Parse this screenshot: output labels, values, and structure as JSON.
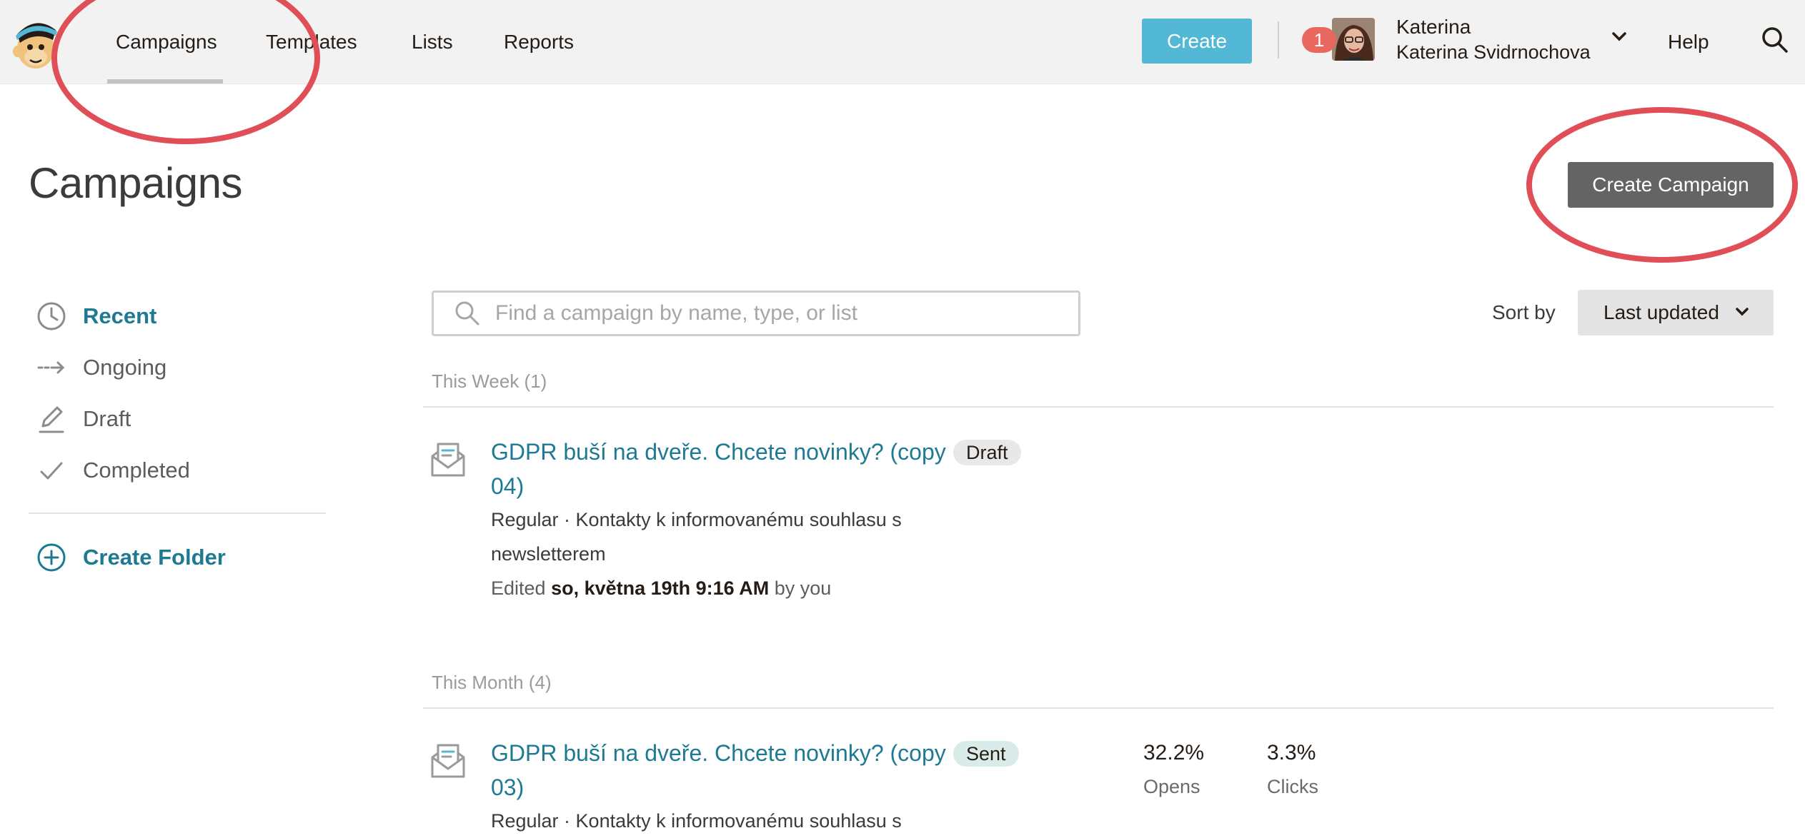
{
  "nav": {
    "items": [
      "Campaigns",
      "Templates",
      "Lists",
      "Reports"
    ],
    "create_label": "Create",
    "notification_count": "1",
    "user_name": "Katerina",
    "user_fullname": "Katerina Svidrnochova",
    "help_label": "Help"
  },
  "page": {
    "title": "Campaigns",
    "create_campaign_label": "Create Campaign"
  },
  "sidebar": {
    "items": [
      {
        "label": "Recent",
        "icon": "clock-icon",
        "active": true
      },
      {
        "label": "Ongoing",
        "icon": "dashed-arrow-icon"
      },
      {
        "label": "Draft",
        "icon": "pencil-icon"
      },
      {
        "label": "Completed",
        "icon": "checkmark-icon"
      }
    ],
    "create_folder_label": "Create Folder"
  },
  "search": {
    "placeholder": "Find a campaign by name, type, or list"
  },
  "sort": {
    "label": "Sort by",
    "value": "Last updated"
  },
  "sections": [
    {
      "label": "This Week (1)",
      "campaigns": [
        {
          "title": "GDPR buší na dveře. Chcete novinky? (copy 04)",
          "status": "Draft",
          "meta": "Regular · Kontakty k informovanému souhlasu s newsletterem",
          "edited_prefix": "Edited",
          "edited_date": "so, května 19th 9:16 AM",
          "edited_suffix": "by you"
        }
      ]
    },
    {
      "label": "This Month (4)",
      "campaigns": [
        {
          "title": "GDPR buší na dveře. Chcete novinky? (copy 03)",
          "status": "Sent",
          "meta": "Regular · Kontakty k informovanému souhlasu s",
          "opens_value": "32.2%",
          "opens_label": "Opens",
          "clicks_value": "3.3%",
          "clicks_label": "Clicks"
        }
      ]
    }
  ],
  "colors": {
    "accent": "#1e7a93",
    "create_button": "#52b8d6",
    "create_campaign_button": "#646464",
    "annotation": "#e04f57",
    "badge": "#e8685f"
  }
}
